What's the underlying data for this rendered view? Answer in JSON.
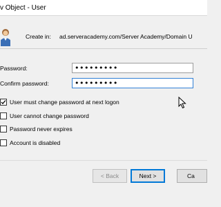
{
  "window": {
    "title": "v Object - User"
  },
  "header": {
    "icon": "user-icon",
    "create_in_label": "Create in:",
    "create_in_value": "ad.serveracademy.com/Server Academy/Domain U"
  },
  "form": {
    "password_label": "Password:",
    "password_value": "•••••••••",
    "confirm_label": "Confirm password:",
    "confirm_value": "•••••••••",
    "options": [
      {
        "label": "User must change password at next logon",
        "checked": true
      },
      {
        "label": "User cannot change password",
        "checked": false
      },
      {
        "label": "Password never expires",
        "checked": false
      },
      {
        "label": "Account is disabled",
        "checked": false
      }
    ]
  },
  "buttons": {
    "back": "< Back",
    "next": "Next >",
    "cancel": "Ca"
  },
  "colors": {
    "focus_border": "#2f7fd6",
    "default_button_border": "#0078d7"
  }
}
